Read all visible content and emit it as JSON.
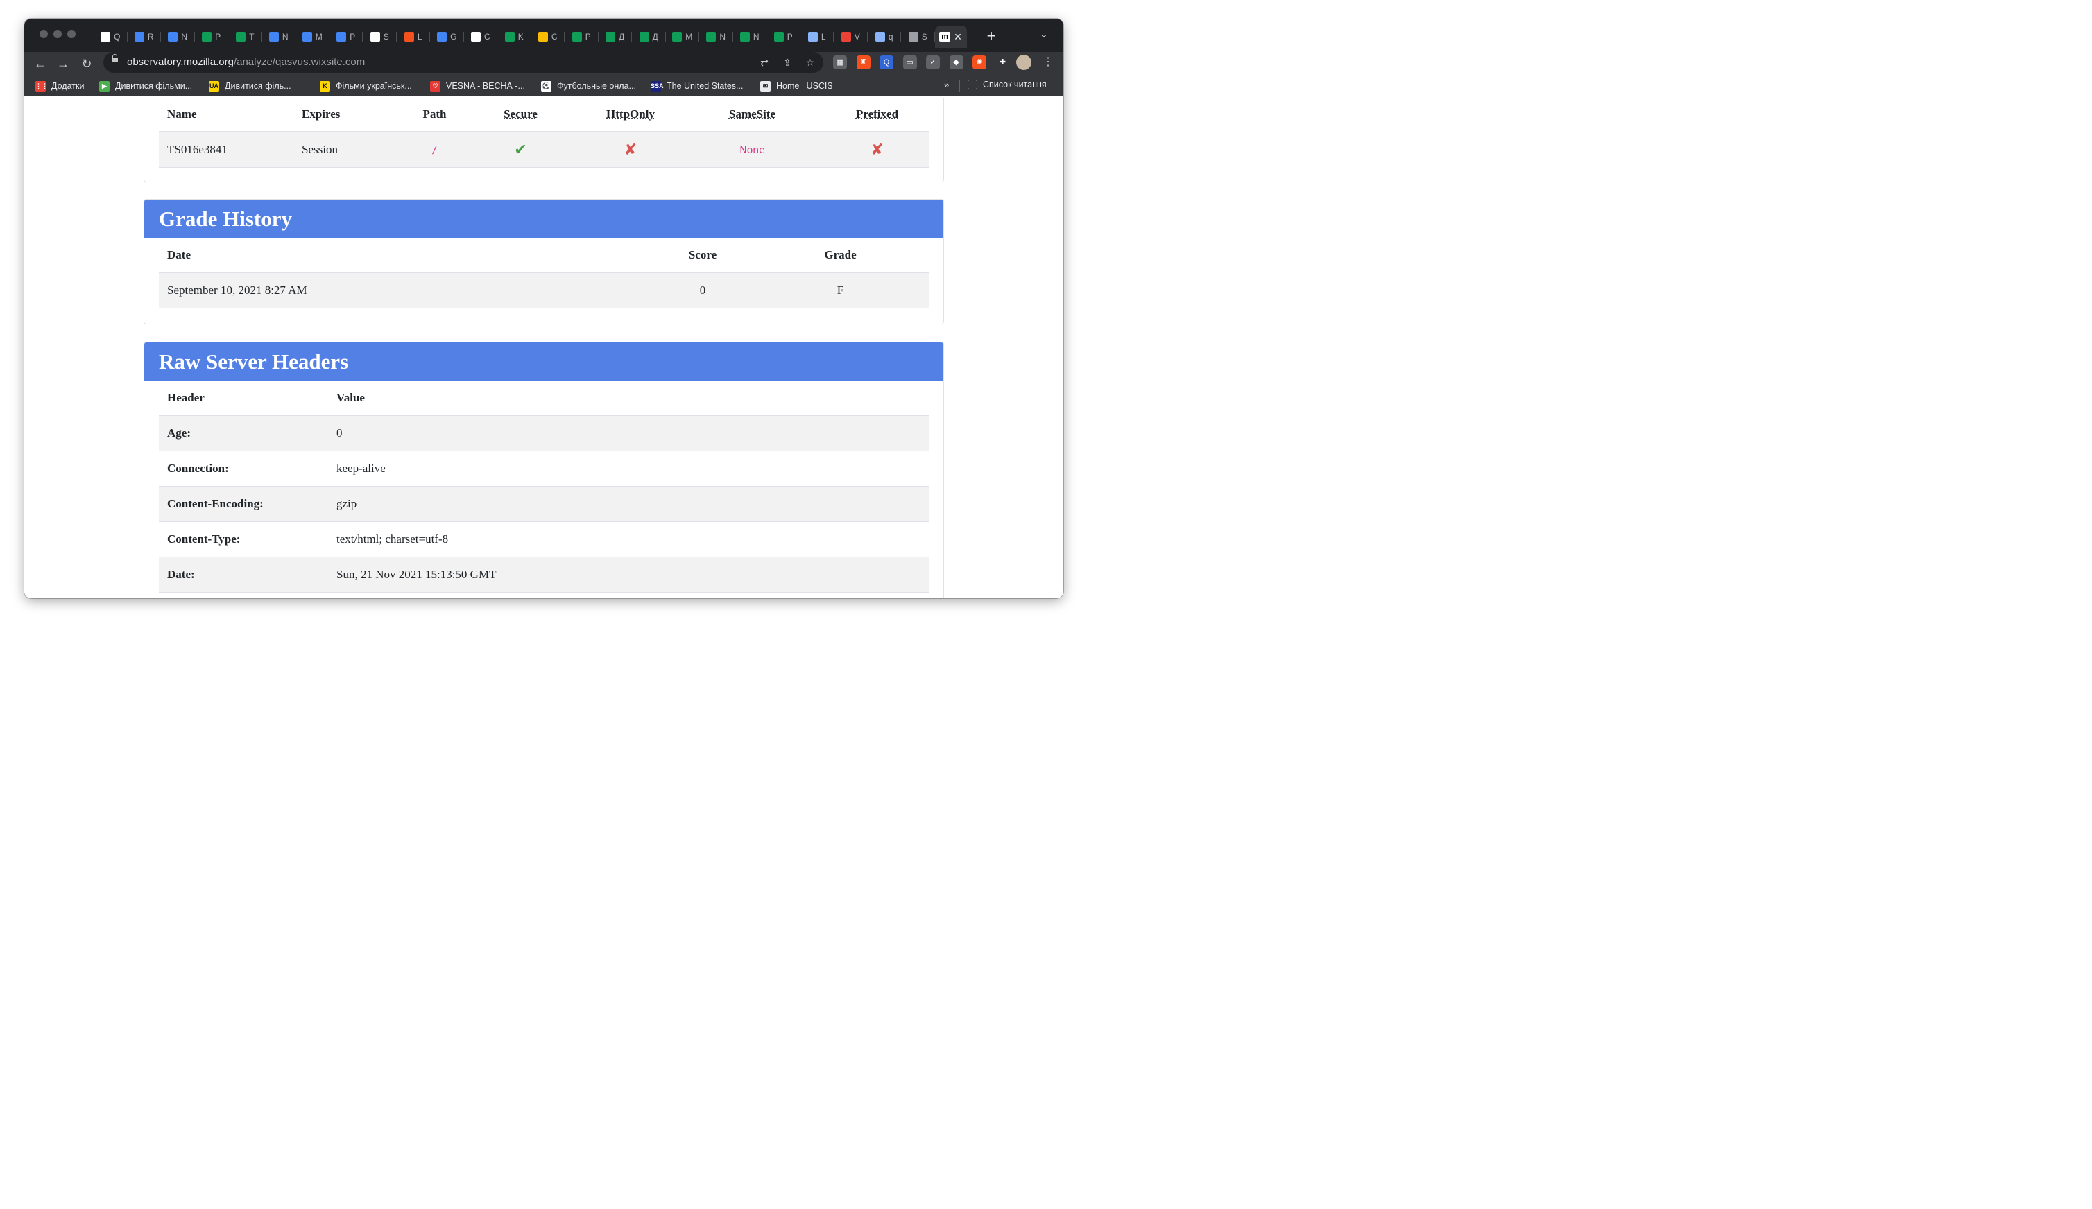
{
  "browser": {
    "tabs": [
      {
        "letter": "Q",
        "icon": "contacts-icon",
        "color": "#ffffff"
      },
      {
        "letter": "R",
        "icon": "docs-icon",
        "color": "#4285f4"
      },
      {
        "letter": "N",
        "icon": "docs-icon",
        "color": "#4285f4"
      },
      {
        "letter": "P",
        "icon": "sheets-icon",
        "color": "#0f9d58"
      },
      {
        "letter": "T",
        "icon": "sheets-icon",
        "color": "#0f9d58"
      },
      {
        "letter": "N",
        "icon": "docs-icon",
        "color": "#4285f4"
      },
      {
        "letter": "M",
        "icon": "docs-icon",
        "color": "#4285f4"
      },
      {
        "letter": "P",
        "icon": "docs-icon",
        "color": "#4285f4"
      },
      {
        "letter": "S",
        "icon": "wix-icon",
        "color": "#ffffff"
      },
      {
        "letter": "L",
        "icon": "lighthouse-icon",
        "color": "#f4511e"
      },
      {
        "letter": "G",
        "icon": "translate-icon",
        "color": "#4285f4"
      },
      {
        "letter": "C",
        "icon": "contacts-icon",
        "color": "#ffffff"
      },
      {
        "letter": "K",
        "icon": "sheets-icon",
        "color": "#0f9d58"
      },
      {
        "letter": "C",
        "icon": "drive-icon",
        "color": "#fbbc04"
      },
      {
        "letter": "P",
        "icon": "sheets-icon",
        "color": "#0f9d58"
      },
      {
        "letter": "Д",
        "icon": "sheets-icon",
        "color": "#0f9d58"
      },
      {
        "letter": "Д",
        "icon": "sheets-icon",
        "color": "#0f9d58"
      },
      {
        "letter": "M",
        "icon": "sheets-icon",
        "color": "#0f9d58"
      },
      {
        "letter": "N",
        "icon": "sheets-icon",
        "color": "#0f9d58"
      },
      {
        "letter": "N",
        "icon": "sheets-icon",
        "color": "#0f9d58"
      },
      {
        "letter": "P",
        "icon": "sheets-icon",
        "color": "#0f9d58"
      },
      {
        "letter": "L",
        "icon": "gt-icon",
        "color": "#8ab4f8"
      },
      {
        "letter": "V",
        "icon": "chrome-icon",
        "color": "#ea4335"
      },
      {
        "letter": "q",
        "icon": "compass-icon",
        "color": "#8ab4f8"
      },
      {
        "letter": "S",
        "icon": "puzzle-icon",
        "color": "#9aa0a6"
      }
    ],
    "active_tab": {
      "icon_text": "m",
      "icon": "mozilla-icon"
    },
    "new_tab_label": "+",
    "tab_menu_label": "⌄",
    "url_host": "observatory.mozilla.org",
    "url_path": "/analyze/qasvus.wixsite.com",
    "bookmarks": [
      {
        "label": "Додатки",
        "icon": "apps-grid-icon",
        "color": "#ea4335",
        "glyph": "⋮⋮"
      },
      {
        "label": "Дивитися фільми...",
        "icon": "film-icon",
        "color": "#4caf50",
        "glyph": "▶"
      },
      {
        "label": "Дивитися філь...",
        "icon": "ua-icon",
        "color": "#ffd600",
        "glyph": "UA"
      },
      {
        "label": "Фільми українськ...",
        "icon": "k-icon",
        "color": "#ffd600",
        "glyph": "K"
      },
      {
        "label": "VESNA - ВЕСНА -...",
        "icon": "vesna-icon",
        "color": "#e53935",
        "glyph": "♡"
      },
      {
        "label": "Футбольные онла...",
        "icon": "football-icon",
        "color": "#ffffff",
        "glyph": "⚽"
      },
      {
        "label": "The United States...",
        "icon": "ssa-icon",
        "color": "#1a237e",
        "glyph": "SSA"
      },
      {
        "label": "Home | USCIS",
        "icon": "uscis-icon",
        "color": "#e8eaed",
        "glyph": "✉"
      }
    ],
    "bookmarks_more": "»",
    "reading_list": "Список читання",
    "extensions": [
      {
        "name": "ext-gray-icon",
        "color": "#5f6368",
        "glyph": "▦"
      },
      {
        "name": "lighthouse-ext-icon",
        "color": "#f4511e",
        "glyph": "♜"
      },
      {
        "name": "q-ext-icon",
        "color": "#3367d6",
        "glyph": "Q"
      },
      {
        "name": "window-ext-icon",
        "color": "#5f6368",
        "glyph": "▭"
      },
      {
        "name": "badge-ext-icon",
        "color": "#5f6368",
        "glyph": "✓"
      },
      {
        "name": "cube-ext-icon",
        "color": "#5f6368",
        "glyph": "◆"
      },
      {
        "name": "orange-ext-icon",
        "color": "#f4511e",
        "glyph": "✺"
      },
      {
        "name": "puzzle-ext-icon",
        "color": "#35363a",
        "glyph": "✚"
      }
    ]
  },
  "cookies": {
    "columns": [
      "Name",
      "Expires",
      "Path",
      "Secure",
      "HttpOnly",
      "SameSite",
      "Prefixed"
    ],
    "rows": [
      {
        "name": "TS016e3841",
        "expires": "Session",
        "path": "/",
        "secure": "✔",
        "httponly": "✘",
        "samesite": "None",
        "prefixed": "✘"
      }
    ]
  },
  "grade_history": {
    "title": "Grade History",
    "columns": [
      "Date",
      "Score",
      "Grade"
    ],
    "rows": [
      {
        "date": "September 10, 2021 8:27 AM",
        "score": "0",
        "grade": "F"
      }
    ]
  },
  "raw_headers": {
    "title": "Raw Server Headers",
    "columns": [
      "Header",
      "Value"
    ],
    "rows": [
      {
        "header": "Age:",
        "value": "0"
      },
      {
        "header": "Connection:",
        "value": "keep-alive"
      },
      {
        "header": "Content-Encoding:",
        "value": "gzip"
      },
      {
        "header": "Content-Type:",
        "value": "text/html; charset=utf-8"
      },
      {
        "header": "Date:",
        "value": "Sun, 21 Nov 2021 15:13:50 GMT"
      }
    ]
  }
}
